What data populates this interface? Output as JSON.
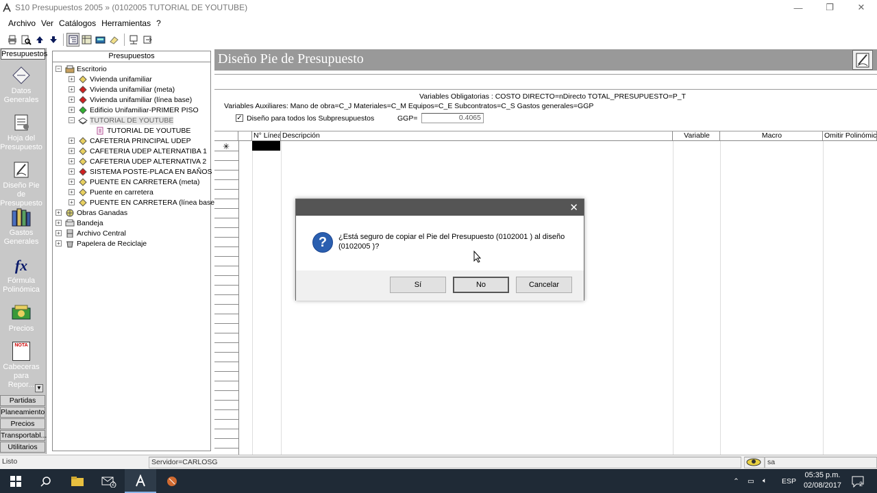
{
  "window": {
    "title": "S10 Presupuestos 2005 » (0102005 TUTORIAL DE YOUTUBE)",
    "minimize_icon": "minimize-icon",
    "maximize_icon": "restore-icon",
    "close_icon": "close-icon"
  },
  "menu": [
    "Archivo",
    "Ver",
    "Catálogos",
    "Herramientas",
    "?"
  ],
  "leftbar": {
    "header": "Presupuestos",
    "items": [
      {
        "label": "Datos Generales",
        "icon": "datos-generales-icon"
      },
      {
        "label": "Hoja del Presupuesto",
        "icon": "hoja-presupuesto-icon"
      },
      {
        "label": "Diseño Pie de Presupuesto",
        "icon": "diseno-pie-icon"
      },
      {
        "label": "Gastos Generales",
        "icon": "gastos-generales-icon"
      },
      {
        "label": "Fórmula Polinómica",
        "icon": "formula-icon",
        "glyph": "fx"
      },
      {
        "label": "Precios",
        "icon": "precios-icon"
      },
      {
        "label": "Cabeceras para Repor...",
        "icon": "cabeceras-icon",
        "glyph": "NOTA"
      }
    ],
    "buttons": [
      "Partidas Ppta.",
      "Planeamiento",
      "Precios",
      "Transportabl...",
      "Utilitarios"
    ]
  },
  "tree": {
    "header": "Presupuestos",
    "rows": [
      {
        "label": "Escritorio",
        "level": 0,
        "exp": "−",
        "icon": "desk"
      },
      {
        "label": "Vivienda unifamiliar",
        "level": 1,
        "exp": "+",
        "icon": "yellow"
      },
      {
        "label": "Vivienda unifamiliar (meta)",
        "level": 1,
        "exp": "+",
        "icon": "red"
      },
      {
        "label": "Vivienda unifamiliar (línea base)",
        "level": 1,
        "exp": "+",
        "icon": "red"
      },
      {
        "label": "Edificio Unifamiliar-PRIMER PISO",
        "level": 1,
        "exp": "+",
        "icon": "green"
      },
      {
        "label": "TUTORIAL DE YOUTUBE",
        "level": 1,
        "exp": "−",
        "icon": "open",
        "selected": true
      },
      {
        "label": "TUTORIAL DE YOUTUBE",
        "level": 2,
        "exp": "",
        "icon": "doc"
      },
      {
        "label": "CAFETERIA PRINCIPAL UDEP",
        "level": 1,
        "exp": "+",
        "icon": "yellow"
      },
      {
        "label": "CAFETERIA UDEP ALTERNATIBA 1",
        "level": 1,
        "exp": "+",
        "icon": "yellow"
      },
      {
        "label": "CAFETERIA UDEP ALTERNATIVA 2",
        "level": 1,
        "exp": "+",
        "icon": "yellow"
      },
      {
        "label": "SISTEMA POSTE-PLACA EN BAÑOS",
        "level": 1,
        "exp": "+",
        "icon": "red"
      },
      {
        "label": "PUENTE EN CARRETERA (meta)",
        "level": 1,
        "exp": "+",
        "icon": "yellow"
      },
      {
        "label": "Puente en carretera",
        "level": 1,
        "exp": "+",
        "icon": "yellow"
      },
      {
        "label": "PUENTE EN CARRETERA (línea base)",
        "level": 1,
        "exp": "+",
        "icon": "yellow"
      },
      {
        "label": "Obras Ganadas",
        "level": 0,
        "exp": "+",
        "icon": "globe"
      },
      {
        "label": "Bandeja",
        "level": 0,
        "exp": "+",
        "icon": "tray"
      },
      {
        "label": "Archivo Central",
        "level": 0,
        "exp": "+",
        "icon": "cabinet"
      },
      {
        "label": "Papelera de Reciclaje",
        "level": 0,
        "exp": "+",
        "icon": "bin"
      }
    ]
  },
  "main": {
    "title": "Diseño Pie de Presupuesto",
    "vars_obligatorias": "Variables Obligatorias : COSTO DIRECTO=nDirecto     TOTAL_PRESUPUESTO=P_T",
    "vars_auxiliares": "Variables Auxiliares: Mano de obra=C_J  Materiales=C_M  Equipos=C_E  Subcontratos=C_S  Gastos generales=GGP",
    "checkbox_label": "Diseño para todos los Subpresupuestos",
    "checkbox_checked": true,
    "ggp_label": "GGP=",
    "ggp_value": "0.4065",
    "columns": [
      "N° Línea",
      "Descripción",
      "Variable",
      "Macro",
      "Omitir Polinómica"
    ],
    "new_row_marker": "✳"
  },
  "dialog": {
    "message": "¿Está seguro de copiar el Pie del Presupuesto (0102001 ) al diseño (0102005 )?",
    "icon": "question-icon",
    "buttons": {
      "yes": "Sí",
      "no": "No",
      "cancel": "Cancelar"
    }
  },
  "status": {
    "left": "Listo",
    "server": "Servidor=CARLOSG (????) ;Base de Datos=S10.1",
    "user": "sa"
  },
  "taskbar": {
    "lang": "ESP",
    "time": "05:35 p.m.",
    "date": "02/08/2017",
    "notif_count": "2",
    "mail_badge": "2"
  }
}
